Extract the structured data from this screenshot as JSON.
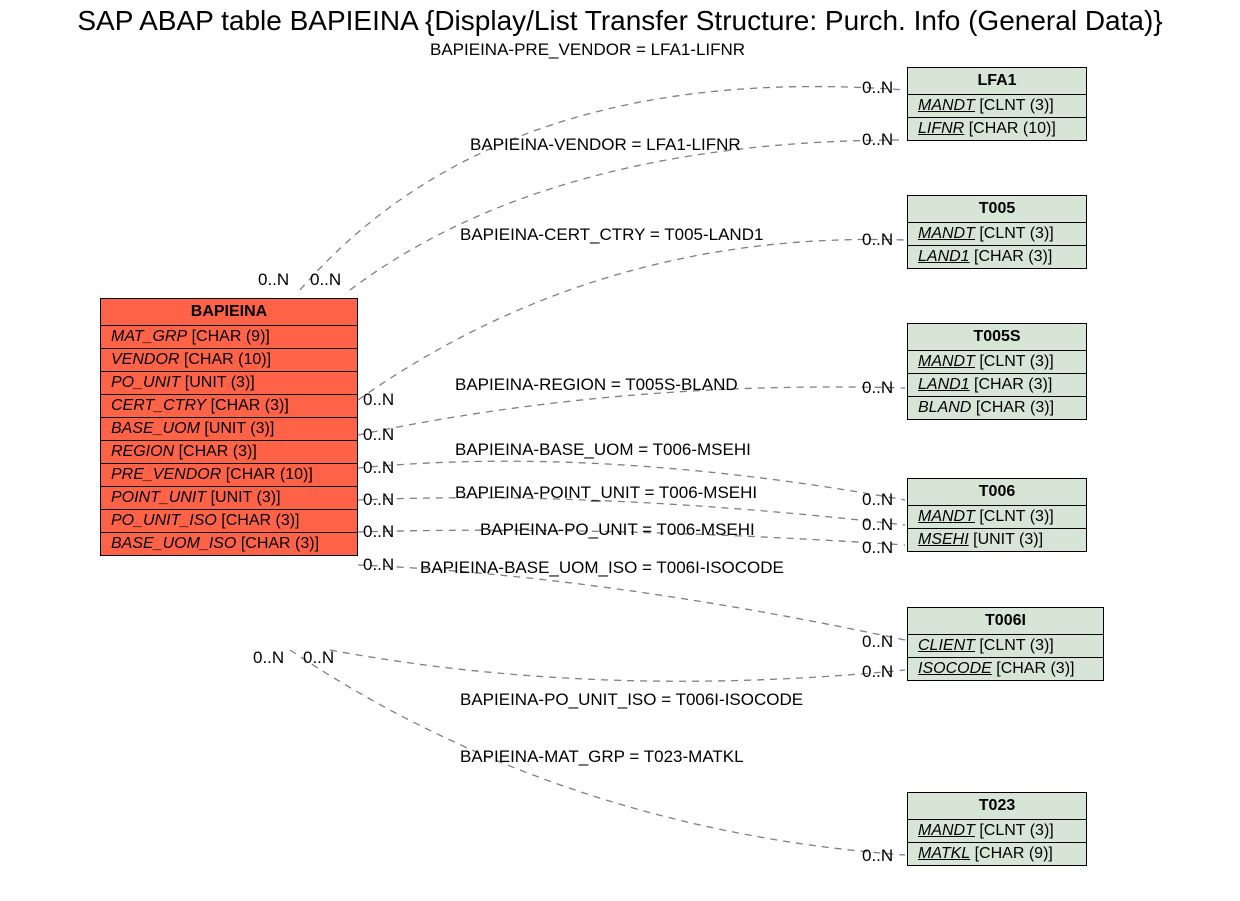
{
  "title": "SAP ABAP table BAPIEINA {Display/List Transfer Structure: Purch. Info (General Data)}",
  "main": {
    "name": "BAPIEINA",
    "fields": [
      {
        "name": "MAT_GRP",
        "type": "[CHAR (9)]"
      },
      {
        "name": "VENDOR",
        "type": "[CHAR (10)]"
      },
      {
        "name": "PO_UNIT",
        "type": "[UNIT (3)]"
      },
      {
        "name": "CERT_CTRY",
        "type": "[CHAR (3)]"
      },
      {
        "name": "BASE_UOM",
        "type": "[UNIT (3)]"
      },
      {
        "name": "REGION",
        "type": "[CHAR (3)]"
      },
      {
        "name": "PRE_VENDOR",
        "type": "[CHAR (10)]"
      },
      {
        "name": "POINT_UNIT",
        "type": "[UNIT (3)]"
      },
      {
        "name": "PO_UNIT_ISO",
        "type": "[CHAR (3)]"
      },
      {
        "name": "BASE_UOM_ISO",
        "type": "[CHAR (3)]"
      }
    ]
  },
  "refs": {
    "lfa1": {
      "name": "LFA1",
      "fields": [
        {
          "name": "MANDT",
          "type": "[CLNT (3)]",
          "ul": true
        },
        {
          "name": "LIFNR",
          "type": "[CHAR (10)]",
          "ul": true
        }
      ]
    },
    "t005": {
      "name": "T005",
      "fields": [
        {
          "name": "MANDT",
          "type": "[CLNT (3)]",
          "ul": true
        },
        {
          "name": "LAND1",
          "type": "[CHAR (3)]",
          "ul": true
        }
      ]
    },
    "t005s": {
      "name": "T005S",
      "fields": [
        {
          "name": "MANDT",
          "type": "[CLNT (3)]",
          "ul": true
        },
        {
          "name": "LAND1",
          "type": "[CHAR (3)]",
          "ul": true
        },
        {
          "name": "BLAND",
          "type": "[CHAR (3)]"
        }
      ]
    },
    "t006": {
      "name": "T006",
      "fields": [
        {
          "name": "MANDT",
          "type": "[CLNT (3)]",
          "ul": true
        },
        {
          "name": "MSEHI",
          "type": "[UNIT (3)]",
          "ul": true
        }
      ]
    },
    "t006i": {
      "name": "T006I",
      "fields": [
        {
          "name": "CLIENT",
          "type": "[CLNT (3)]",
          "ul": true
        },
        {
          "name": "ISOCODE",
          "type": "[CHAR (3)]",
          "ul": true
        }
      ]
    },
    "t023": {
      "name": "T023",
      "fields": [
        {
          "name": "MANDT",
          "type": "[CLNT (3)]",
          "ul": true
        },
        {
          "name": "MATKL",
          "type": "[CHAR (9)]",
          "ul": true
        }
      ]
    }
  },
  "rels": {
    "r0": "BAPIEINA-PRE_VENDOR = LFA1-LIFNR",
    "r1": "BAPIEINA-VENDOR = LFA1-LIFNR",
    "r2": "BAPIEINA-CERT_CTRY = T005-LAND1",
    "r3": "BAPIEINA-REGION = T005S-BLAND",
    "r4": "BAPIEINA-BASE_UOM = T006-MSEHI",
    "r5": "BAPIEINA-POINT_UNIT = T006-MSEHI",
    "r6": "BAPIEINA-PO_UNIT = T006-MSEHI",
    "r7": "BAPIEINA-BASE_UOM_ISO = T006I-ISOCODE",
    "r8": "BAPIEINA-PO_UNIT_ISO = T006I-ISOCODE",
    "r9": "BAPIEINA-MAT_GRP = T023-MATKL"
  },
  "card": "0..N"
}
